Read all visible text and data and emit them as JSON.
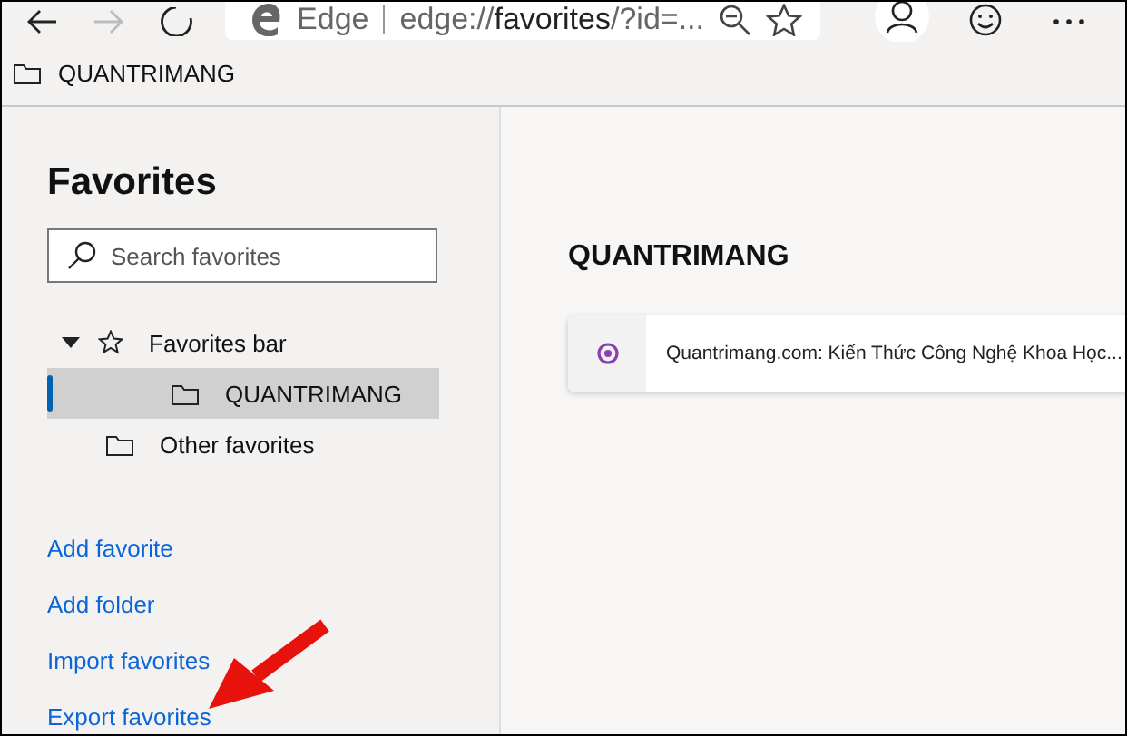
{
  "toolbar": {
    "address": {
      "brand": "Edge",
      "scheme": "edge://",
      "host": "favorites",
      "rest": "/?id=..."
    }
  },
  "favorites_bar": [
    {
      "label": "QUANTRIMANG"
    }
  ],
  "sidebar": {
    "title": "Favorites",
    "search": {
      "placeholder": "Search favorites"
    },
    "tree": [
      {
        "label": "Favorites bar",
        "kind": "star",
        "expanded": true,
        "selected": false,
        "children": [
          {
            "label": "QUANTRIMANG",
            "kind": "folder",
            "selected": true
          }
        ]
      },
      {
        "label": "Other favorites",
        "kind": "folder",
        "selected": false
      }
    ],
    "links": [
      "Add favorite",
      "Add folder",
      "Import favorites",
      "Export favorites"
    ]
  },
  "content": {
    "heading": "QUANTRIMANG",
    "items": [
      {
        "title": "Quantrimang.com: Kiến Thức Công Nghệ Khoa Học..."
      }
    ]
  }
}
